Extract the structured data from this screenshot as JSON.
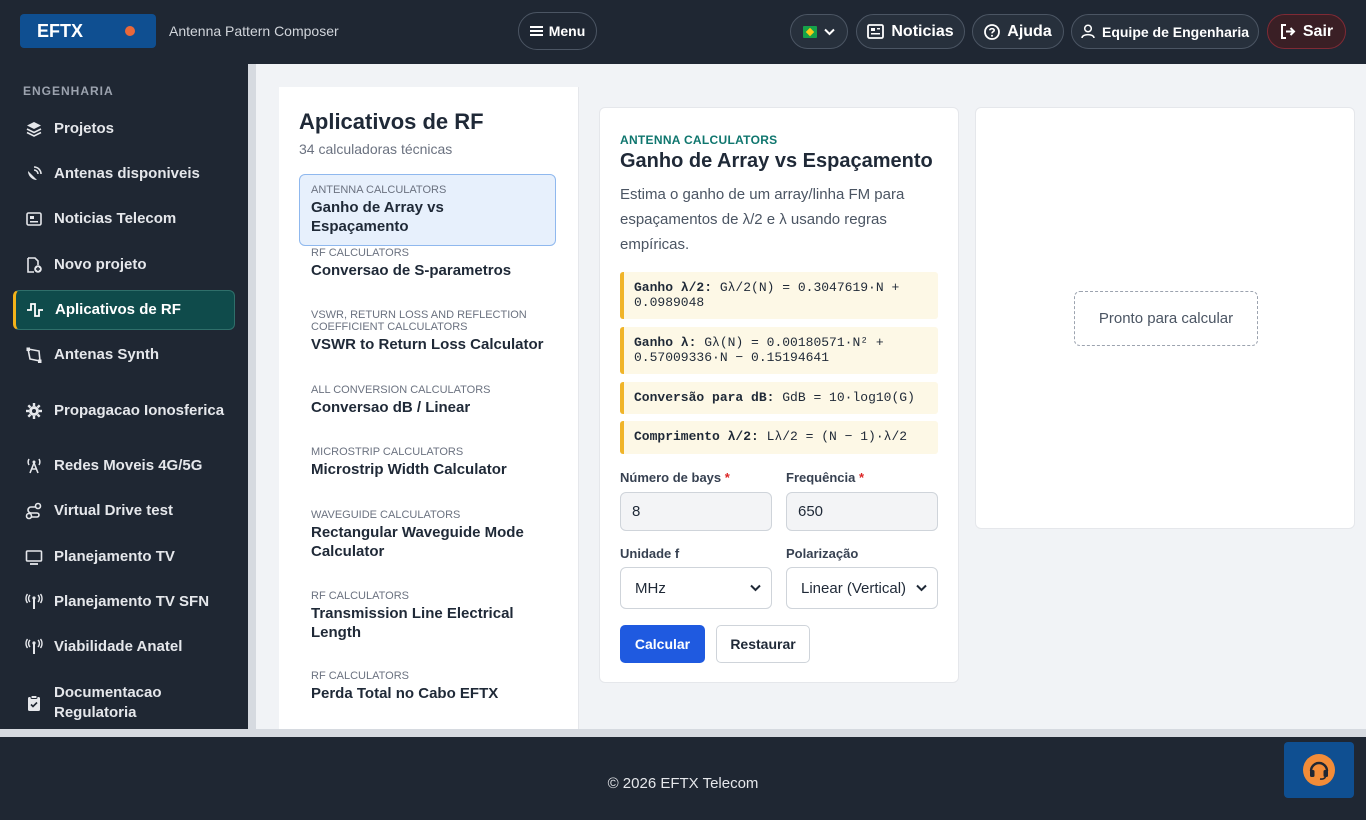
{
  "header": {
    "brand": "EFTX",
    "app_title": "Antenna Pattern Composer",
    "menu_label": "Menu",
    "news_label": "Noticias",
    "help_label": "Ajuda",
    "team_label": "Equipe de Engenharia",
    "logout_label": "Sair"
  },
  "sidebar": {
    "section": "ENGENHARIA",
    "items": [
      {
        "label": "Projetos"
      },
      {
        "label": "Antenas disponiveis"
      },
      {
        "label": "Noticias Telecom"
      },
      {
        "label": "Novo projeto"
      },
      {
        "label": "Aplicativos de RF"
      },
      {
        "label": "Antenas Synth"
      },
      {
        "label": "Propagacao Ionosferica"
      },
      {
        "label": "Redes Moveis 4G/5G"
      },
      {
        "label": "Virtual Drive test"
      },
      {
        "label": "Planejamento TV"
      },
      {
        "label": "Planejamento TV SFN"
      },
      {
        "label": "Viabilidade Anatel"
      },
      {
        "label": "Documentacao Regulatoria"
      }
    ]
  },
  "list": {
    "title": "Aplicativos de RF",
    "subtitle": "34 calculadoras técnicas",
    "items": [
      {
        "category": "ANTENNA CALCULATORS",
        "name": "Ganho de Array vs Espaçamento"
      },
      {
        "category": "RF CALCULATORS",
        "name": "Conversao de S-parametros"
      },
      {
        "category": "VSWR, RETURN LOSS AND REFLECTION COEFFICIENT CALCULATORS",
        "name": "VSWR to Return Loss Calculator"
      },
      {
        "category": "ALL CONVERSION CALCULATORS",
        "name": "Conversao dB / Linear"
      },
      {
        "category": "MICROSTRIP CALCULATORS",
        "name": "Microstrip Width Calculator"
      },
      {
        "category": "WAVEGUIDE CALCULATORS",
        "name": "Rectangular Waveguide Mode Calculator"
      },
      {
        "category": "RF CALCULATORS",
        "name": "Transmission Line Electrical Length"
      },
      {
        "category": "RF CALCULATORS",
        "name": "Perda Total no Cabo EFTX"
      }
    ]
  },
  "form": {
    "category": "ANTENNA CALCULATORS",
    "title": "Ganho de Array vs Espaçamento",
    "description": "Estima o ganho de um array/linha FM para espaçamentos de λ/2 e λ usando regras empíricas.",
    "formulas": [
      {
        "label": "Ganho λ/2:",
        "expr": "Gλ/2(N) = 0.3047619·N + 0.0989048"
      },
      {
        "label": "Ganho λ:",
        "expr": "Gλ(N) = 0.00180571·N² + 0.57009336·N − 0.15194641"
      },
      {
        "label": "Conversão para dB:",
        "expr": "GdB = 10·log10(G)"
      },
      {
        "label": "Comprimento λ/2:",
        "expr": "Lλ/2 = (N − 1)·λ/2"
      }
    ],
    "bays_label": "Número de bays",
    "bays_value": "8",
    "freq_label": "Frequência",
    "freq_value": "650",
    "required_mark": "*",
    "unit_label": "Unidade f",
    "unit_value": "MHz",
    "pol_label": "Polarização",
    "pol_value": "Linear (Vertical)",
    "calc_label": "Calcular",
    "reset_label": "Restaurar"
  },
  "result": {
    "ready": "Pronto para calcular"
  },
  "footer": {
    "copyright": "© 2026 EFTX Telecom"
  }
}
